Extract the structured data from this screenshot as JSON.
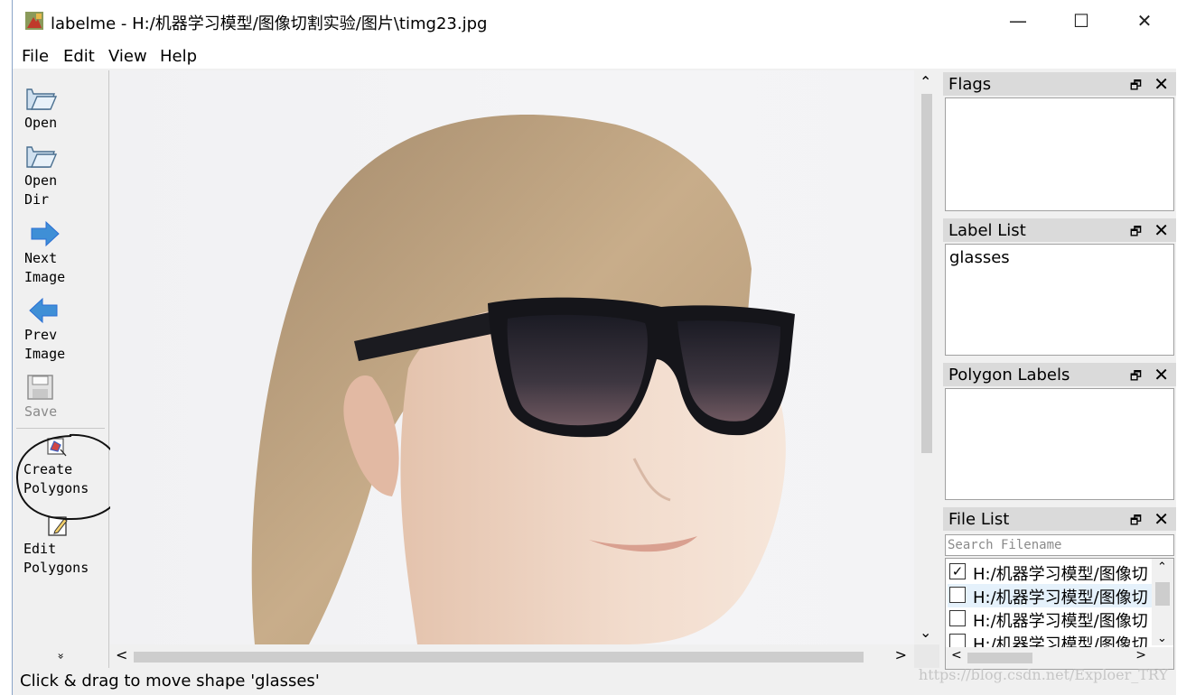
{
  "window": {
    "title": "labelme - H:/机器学习模型/图像切割实验/图片\\timg23.jpg",
    "minimize": "—",
    "maximize": "☐",
    "close": "✕"
  },
  "menu": [
    "File",
    "Edit",
    "View",
    "Help"
  ],
  "toolbar": {
    "open": "Open",
    "open_dir": "Open\nDir",
    "next_image": "Next\nImage",
    "prev_image": "Prev\nImage",
    "save": "Save",
    "create_polygons": "Create\nPolygons",
    "edit_polygons": "Edit\nPolygons",
    "overflow": "»"
  },
  "scroll": {
    "up": "⌃",
    "down": "⌄",
    "left": "<",
    "right": ">"
  },
  "docks": {
    "flags": {
      "title": "Flags",
      "float": "🗗",
      "close": "✕"
    },
    "label_list": {
      "title": "Label List",
      "float": "🗗",
      "close": "✕",
      "items": [
        "glasses"
      ]
    },
    "polygon_labels": {
      "title": "Polygon Labels",
      "float": "🗗",
      "close": "✕"
    },
    "file_list": {
      "title": "File List",
      "float": "🗗",
      "close": "✕",
      "search_placeholder": "Search Filename",
      "files": [
        {
          "name": "H:/机器学习模型/图像切",
          "checked": true,
          "mark": "✓"
        },
        {
          "name": "H:/机器学习模型/图像切",
          "checked": false,
          "mark": ""
        },
        {
          "name": "H:/机器学习模型/图像切",
          "checked": false,
          "mark": ""
        },
        {
          "name": "H:/机器学习模型/图像切",
          "checked": false,
          "mark": ""
        }
      ]
    }
  },
  "status": "Click & drag to move shape 'glasses'",
  "watermark": "https://blog.csdn.net/Exploer_TRY",
  "colors": {
    "accent": "#2a6ed4",
    "selection": "#e5f1fb",
    "panel_header": "#dadada"
  }
}
